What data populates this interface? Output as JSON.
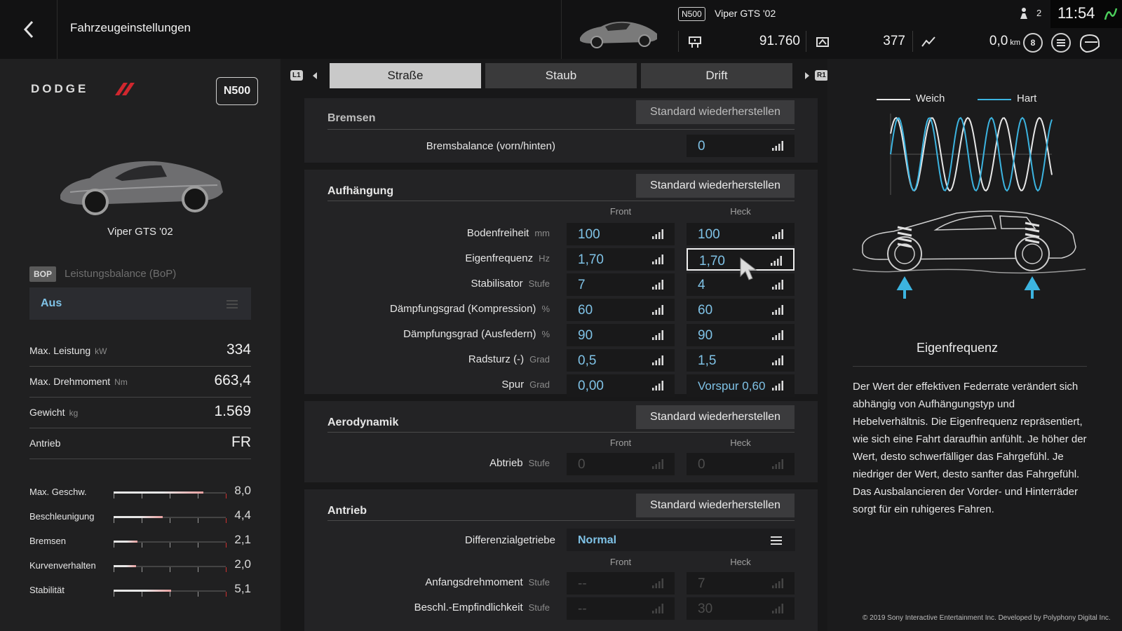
{
  "header": {
    "title": "Fahrzeugeinstellungen",
    "car_class": "N500",
    "car_name": "Viper GTS '02",
    "credits": "91.760",
    "mileage_points": "377",
    "distance": "0,0",
    "distance_unit": "km",
    "friends_count": "2",
    "clock": "11:54",
    "level": "8"
  },
  "car": {
    "brand": "DODGE",
    "class": "N500",
    "name": "Viper GTS '02"
  },
  "bop": {
    "badge": "BOP",
    "label": "Leistungsbalance (BoP)",
    "value": "Aus"
  },
  "specs": [
    {
      "label": "Max. Leistung",
      "unit": "kW",
      "value": "334"
    },
    {
      "label": "Max. Drehmoment",
      "unit": "Nm",
      "value": "663,4"
    },
    {
      "label": "Gewicht",
      "unit": "kg",
      "value": "1.569"
    },
    {
      "label": "Antrieb",
      "unit": "",
      "value": "FR"
    }
  ],
  "performance": [
    {
      "label": "Max. Geschw.",
      "value": "8,0",
      "level": 0.8
    },
    {
      "label": "Beschleunigung",
      "value": "4,4",
      "level": 0.44
    },
    {
      "label": "Bremsen",
      "value": "2,1",
      "level": 0.21
    },
    {
      "label": "Kurvenverhalten",
      "value": "2,0",
      "level": 0.2
    },
    {
      "label": "Stabilität",
      "value": "5,1",
      "level": 0.51
    }
  ],
  "tabs": {
    "left_button": "L1",
    "right_button": "R1",
    "items": [
      "Straße",
      "Staub",
      "Drift"
    ],
    "active": "Straße"
  },
  "reset_label": "Standard wiederherstellen",
  "brakes": {
    "title": "Bremsen",
    "balance_label": "Bremsbalance (vorn/hinten)",
    "balance_value": "0"
  },
  "suspension": {
    "title": "Aufhängung",
    "front": "Front",
    "rear": "Heck",
    "rows": [
      {
        "label": "Bodenfreiheit",
        "unit": "mm",
        "front": "100",
        "rear": "100"
      },
      {
        "label": "Eigenfrequenz",
        "unit": "Hz",
        "front": "1,70",
        "rear": "1,70"
      },
      {
        "label": "Stabilisator",
        "unit": "Stufe",
        "front": "7",
        "rear": "4"
      },
      {
        "label": "Dämpfungsgrad (Kompression)",
        "unit": "%",
        "front": "60",
        "rear": "60"
      },
      {
        "label": "Dämpfungsgrad (Ausfedern)",
        "unit": "%",
        "front": "90",
        "rear": "90"
      },
      {
        "label": "Radsturz (-)",
        "unit": "Grad",
        "front": "0,5",
        "rear": "1,5"
      },
      {
        "label": "Spur",
        "unit": "Grad",
        "front": "0,00",
        "rear": "Vorspur 0,60"
      }
    ]
  },
  "aero": {
    "title": "Aerodynamik",
    "front": "Front",
    "rear": "Heck",
    "label": "Abtrieb",
    "unit": "Stufe",
    "front_value": "0",
    "rear_value": "0"
  },
  "drivetrain": {
    "title": "Antrieb",
    "diff_label": "Differenzialgetriebe",
    "diff_value": "Normal",
    "front": "Front",
    "rear": "Heck",
    "rows": [
      {
        "label": "Anfangsdrehmoment",
        "unit": "Stufe",
        "front": "--",
        "rear": "7"
      },
      {
        "label": "Beschl.-Empfindlichkeit",
        "unit": "Stufe",
        "front": "--",
        "rear": "30"
      }
    ]
  },
  "info": {
    "legend_soft": "Weich",
    "legend_hard": "Hart",
    "title": "Eigenfrequenz",
    "text": "Der Wert der effektiven Federrate verändert sich abhängig von Aufhängungstyp und Hebelverhältnis. Die Eigenfrequenz repräsentiert, wie sich eine Fahrt daraufhin anfühlt. Je höher der Wert, desto schwerfälliger das Fahrgefühl. Je niedriger der Wert, desto sanfter das Fahrgefühl. Das Ausbalancieren der Vorder- und Hinterräder sorgt für ein ruhigeres Fahren."
  },
  "copyright": "© 2019 Sony Interactive Entertainment Inc. Developed by Polyphony Digital Inc.",
  "colors": {
    "accent_blue": "#7fc2e6",
    "soft_wave": "#e8e8e8",
    "hard_wave": "#3cb4e0",
    "bar_fill": "#e8a0a0"
  }
}
